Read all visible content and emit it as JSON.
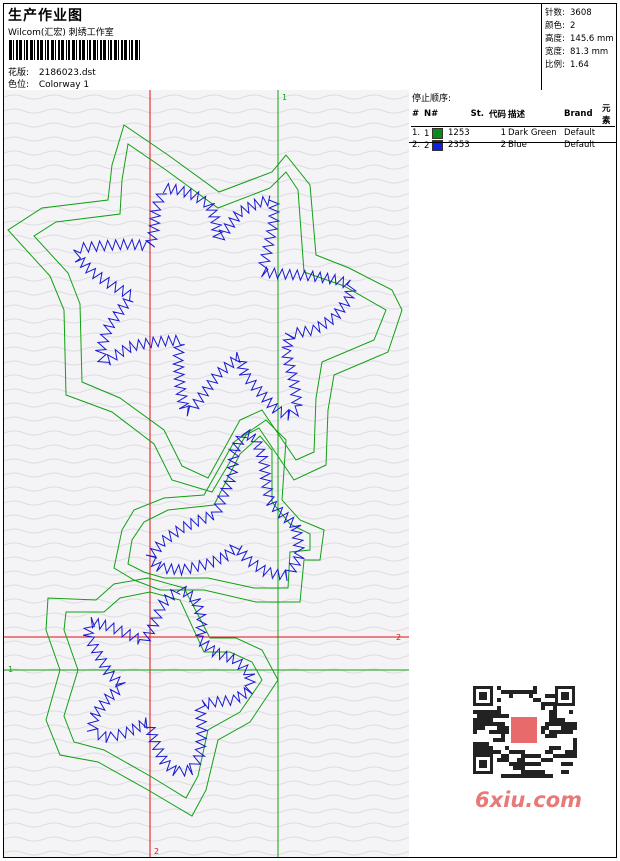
{
  "header": {
    "title": "生产作业图",
    "company": "Wilcom(汇宏) 刺绣工作室",
    "design_label": "花版:",
    "design_value": "2186023.dst",
    "colorway_label": "色位:",
    "colorway_value": "Colorway 1"
  },
  "stats": [
    {
      "label": "针数:",
      "value": "3608"
    },
    {
      "label": "颜色:",
      "value": "2"
    },
    {
      "label": "高度:",
      "value": "145.6 mm"
    },
    {
      "label": "宽度:",
      "value": "81.3 mm"
    },
    {
      "label": "比例:",
      "value": "1.64"
    }
  ],
  "stop_sequence": {
    "title": "停止顺序:",
    "columns": [
      "#",
      "N#",
      "St.",
      "代码",
      "描述",
      "Brand",
      "元素"
    ],
    "rows": [
      {
        "idx": "1.",
        "n": "1",
        "stitches": "1253",
        "code": "1",
        "desc": "Dark Green",
        "brand": "Default",
        "color": "#0a8a1a"
      },
      {
        "idx": "2.",
        "n": "2",
        "stitches": "2353",
        "code": "2",
        "desc": "Blue",
        "brand": "Default",
        "color": "#1020e0"
      }
    ]
  },
  "guides": {
    "green_label": "1",
    "red_label": "2"
  },
  "watermark": "6xiu.com",
  "colors": {
    "green": "#12a012",
    "red": "#e01010",
    "blue": "#1a1ad0"
  }
}
